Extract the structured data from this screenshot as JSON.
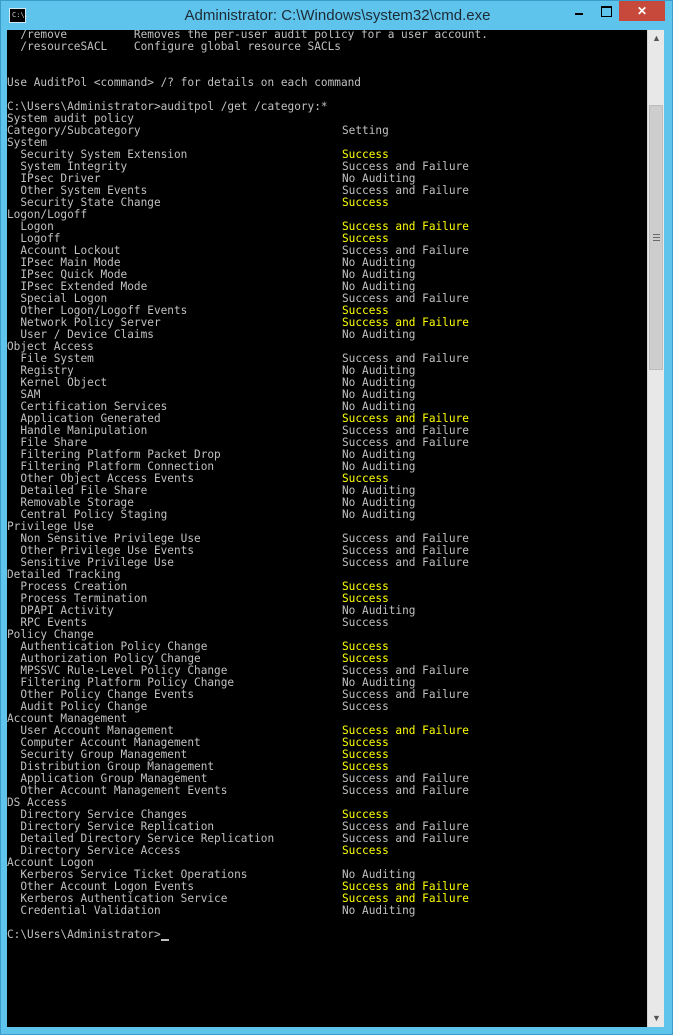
{
  "window": {
    "title": "Administrator: C:\\Windows\\system32\\cmd.exe",
    "icon_label": "C:\\.",
    "min_icon": "minimize-icon",
    "max_icon": "maximize-icon",
    "close_icon": "close-icon",
    "close_glyph": "✕"
  },
  "colors": {
    "titlebar": "#5fc4ec",
    "console_bg": "#000000",
    "text": "#c0c0c0",
    "highlight": "#ffff00",
    "close": "#c7493c"
  },
  "console": {
    "lines": [
      {
        "a": "  /remove          Removes the per-user audit policy for a user account.",
        "b": "",
        "y": false
      },
      {
        "a": "  /resourceSACL    Configure global resource SACLs",
        "b": "",
        "y": false
      },
      {
        "a": "",
        "b": "",
        "y": false
      },
      {
        "a": "",
        "b": "",
        "y": false
      },
      {
        "a": "Use AuditPol <command> /? for details on each command",
        "b": "",
        "y": false
      },
      {
        "a": "",
        "b": "",
        "y": false
      },
      {
        "a": "C:\\Users\\Administrator>auditpol /get /category:*",
        "b": "",
        "y": false
      },
      {
        "a": "System audit policy",
        "b": "",
        "y": false
      },
      {
        "a": "Category/Subcategory",
        "b": "Setting",
        "y": false
      },
      {
        "a": "System",
        "b": "",
        "y": false
      },
      {
        "a": "  Security System Extension",
        "b": "Success",
        "y": true
      },
      {
        "a": "  System Integrity",
        "b": "Success and Failure",
        "y": false
      },
      {
        "a": "  IPsec Driver",
        "b": "No Auditing",
        "y": false
      },
      {
        "a": "  Other System Events",
        "b": "Success and Failure",
        "y": false
      },
      {
        "a": "  Security State Change",
        "b": "Success",
        "y": true
      },
      {
        "a": "Logon/Logoff",
        "b": "",
        "y": false
      },
      {
        "a": "  Logon",
        "b": "Success and Failure",
        "y": true
      },
      {
        "a": "  Logoff",
        "b": "Success",
        "y": true
      },
      {
        "a": "  Account Lockout",
        "b": "Success and Failure",
        "y": false
      },
      {
        "a": "  IPsec Main Mode",
        "b": "No Auditing",
        "y": false
      },
      {
        "a": "  IPsec Quick Mode",
        "b": "No Auditing",
        "y": false
      },
      {
        "a": "  IPsec Extended Mode",
        "b": "No Auditing",
        "y": false
      },
      {
        "a": "  Special Logon",
        "b": "Success and Failure",
        "y": false
      },
      {
        "a": "  Other Logon/Logoff Events",
        "b": "Success",
        "y": true
      },
      {
        "a": "  Network Policy Server",
        "b": "Success and Failure",
        "y": true
      },
      {
        "a": "  User / Device Claims",
        "b": "No Auditing",
        "y": false
      },
      {
        "a": "Object Access",
        "b": "",
        "y": false
      },
      {
        "a": "  File System",
        "b": "Success and Failure",
        "y": false
      },
      {
        "a": "  Registry",
        "b": "No Auditing",
        "y": false
      },
      {
        "a": "  Kernel Object",
        "b": "No Auditing",
        "y": false
      },
      {
        "a": "  SAM",
        "b": "No Auditing",
        "y": false
      },
      {
        "a": "  Certification Services",
        "b": "No Auditing",
        "y": false
      },
      {
        "a": "  Application Generated",
        "b": "Success and Failure",
        "y": true
      },
      {
        "a": "  Handle Manipulation",
        "b": "Success and Failure",
        "y": false
      },
      {
        "a": "  File Share",
        "b": "Success and Failure",
        "y": false
      },
      {
        "a": "  Filtering Platform Packet Drop",
        "b": "No Auditing",
        "y": false
      },
      {
        "a": "  Filtering Platform Connection",
        "b": "No Auditing",
        "y": false
      },
      {
        "a": "  Other Object Access Events",
        "b": "Success",
        "y": true
      },
      {
        "a": "  Detailed File Share",
        "b": "No Auditing",
        "y": false
      },
      {
        "a": "  Removable Storage",
        "b": "No Auditing",
        "y": false
      },
      {
        "a": "  Central Policy Staging",
        "b": "No Auditing",
        "y": false
      },
      {
        "a": "Privilege Use",
        "b": "",
        "y": false
      },
      {
        "a": "  Non Sensitive Privilege Use",
        "b": "Success and Failure",
        "y": false
      },
      {
        "a": "  Other Privilege Use Events",
        "b": "Success and Failure",
        "y": false
      },
      {
        "a": "  Sensitive Privilege Use",
        "b": "Success and Failure",
        "y": false
      },
      {
        "a": "Detailed Tracking",
        "b": "",
        "y": false
      },
      {
        "a": "  Process Creation",
        "b": "Success",
        "y": true
      },
      {
        "a": "  Process Termination",
        "b": "Success",
        "y": true
      },
      {
        "a": "  DPAPI Activity",
        "b": "No Auditing",
        "y": false
      },
      {
        "a": "  RPC Events",
        "b": "Success",
        "y": false
      },
      {
        "a": "Policy Change",
        "b": "",
        "y": false
      },
      {
        "a": "  Authentication Policy Change",
        "b": "Success",
        "y": true
      },
      {
        "a": "  Authorization Policy Change",
        "b": "Success",
        "y": true
      },
      {
        "a": "  MPSSVC Rule-Level Policy Change",
        "b": "Success and Failure",
        "y": false
      },
      {
        "a": "  Filtering Platform Policy Change",
        "b": "No Auditing",
        "y": false
      },
      {
        "a": "  Other Policy Change Events",
        "b": "Success and Failure",
        "y": false
      },
      {
        "a": "  Audit Policy Change",
        "b": "Success",
        "y": false
      },
      {
        "a": "Account Management",
        "b": "",
        "y": false
      },
      {
        "a": "  User Account Management",
        "b": "Success and Failure",
        "y": true
      },
      {
        "a": "  Computer Account Management",
        "b": "Success",
        "y": true
      },
      {
        "a": "  Security Group Management",
        "b": "Success",
        "y": true
      },
      {
        "a": "  Distribution Group Management",
        "b": "Success",
        "y": true
      },
      {
        "a": "  Application Group Management",
        "b": "Success and Failure",
        "y": false
      },
      {
        "a": "  Other Account Management Events",
        "b": "Success and Failure",
        "y": false
      },
      {
        "a": "DS Access",
        "b": "",
        "y": false
      },
      {
        "a": "  Directory Service Changes",
        "b": "Success",
        "y": true
      },
      {
        "a": "  Directory Service Replication",
        "b": "Success and Failure",
        "y": false
      },
      {
        "a": "  Detailed Directory Service Replication",
        "b": "Success and Failure",
        "y": false
      },
      {
        "a": "  Directory Service Access",
        "b": "Success",
        "y": true
      },
      {
        "a": "Account Logon",
        "b": "",
        "y": false
      },
      {
        "a": "  Kerberos Service Ticket Operations",
        "b": "No Auditing",
        "y": false
      },
      {
        "a": "  Other Account Logon Events",
        "b": "Success and Failure",
        "y": true
      },
      {
        "a": "  Kerberos Authentication Service",
        "b": "Success and Failure",
        "y": true
      },
      {
        "a": "  Credential Validation",
        "b": "No Auditing",
        "y": false
      },
      {
        "a": "",
        "b": "",
        "y": false
      },
      {
        "a": "C:\\Users\\Administrator>",
        "b": "",
        "y": false,
        "cursor": true
      }
    ]
  },
  "scrollbar": {
    "up_icon": "scroll-up-icon",
    "down_icon": "scroll-down-icon",
    "up_glyph": "▲",
    "down_glyph": "▼"
  }
}
